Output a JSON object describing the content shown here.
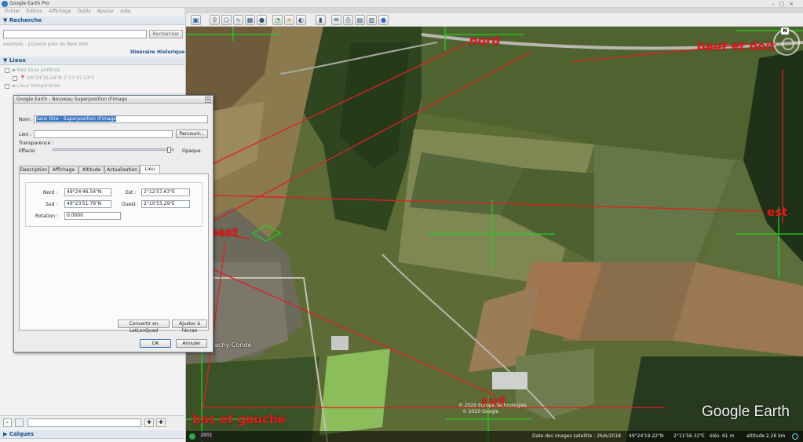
{
  "window": {
    "title": "Google Earth Pro"
  },
  "menu": {
    "items": [
      "Fichier",
      "Édition",
      "Affichage",
      "Outils",
      "Ajouter",
      "Aide"
    ]
  },
  "search": {
    "header": "Recherche",
    "button_label": "Rechercher",
    "example": "exemple : pizzeria près de New York",
    "links": {
      "itineraire": "Itinéraire",
      "historique": "Historique"
    }
  },
  "places": {
    "header": "Lieux",
    "items": [
      "Mes lieux préférés",
      "49°24'16.54\"N   2°11'47.53\"E",
      "Lieux temporaires"
    ]
  },
  "layers": {
    "header": "Calques"
  },
  "dialog": {
    "title": "Google Earth - Nouveau Superposition d'image",
    "close_label": "×",
    "name_label": "Nom :",
    "name_value": "Sans titre - Superposition d'image",
    "link_label": "Lien :",
    "browse_label": "Parcourir...",
    "transparency_label": "Transparence :",
    "transparency_level": 0.97,
    "clear_label": "Effacer",
    "opaque_label": "Opaque",
    "tabs": [
      "Description",
      "Affichage",
      "Altitude",
      "Actualisation",
      "Lieu"
    ],
    "active_tab": "Lieu",
    "north_label": "Nord :",
    "north_value": "49°24'46.54\"N",
    "south_label": "Sud :",
    "south_value": "49°23'51.79\"N",
    "east_label": "Est :",
    "east_value": "2°12'57.63\"E",
    "west_label": "Ouest :",
    "west_value": "2°10'53.29\"E",
    "rotation_label": "Rotation :",
    "rotation_value": "0.0000",
    "convert_button": "Convertir en LatLonQuad",
    "fit_button": "Ajuster à l'écran",
    "ok_button": "OK",
    "cancel_button": "Annuler"
  },
  "map": {
    "place_label": "achy-Condé",
    "brand": "Google Earth",
    "copyright_1": "© 2020 Europa Technologies",
    "copyright_2": "© 2020 Google",
    "year_badge": "2001",
    "status": {
      "imagery_date": "Date des images satellite : 26/6/2018",
      "lat": "49°24'19.22\"N",
      "lon": "2°11'56.32\"E",
      "elevation": "élév.   61 m",
      "altitude": "altitude   2.26 km"
    },
    "compass_n": "N"
  },
  "annotations": {
    "nord": "nord",
    "haut_droit": "haut et doit",
    "est": "est",
    "ouest": "ouest",
    "sud": "sud",
    "bas_gauche": "bas et gauche",
    "color": "#e21b1b"
  },
  "colors": {
    "grid": "#21d021",
    "annotation_lines": "#e02020",
    "panel_header": "#dfe6ee",
    "link": "#1a4e8f"
  }
}
